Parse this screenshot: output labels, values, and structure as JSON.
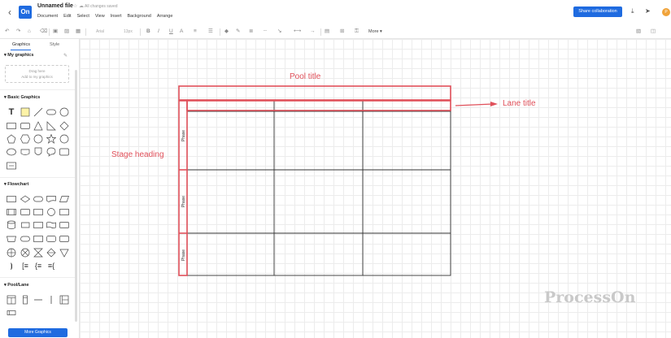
{
  "header": {
    "file_title": "Unnamed file",
    "save_status": "All changes saved",
    "menu": [
      "Document",
      "Edit",
      "Select",
      "View",
      "Insert",
      "Background",
      "Arrange"
    ],
    "share_button": "Share collaboration",
    "logo": "On",
    "avatar_initial": "P"
  },
  "toolbar": {
    "font_family": "Arial",
    "font_size": "13px",
    "more_label": "More"
  },
  "sidebar": {
    "tabs": [
      "Graphics",
      "Style"
    ],
    "my_graphics": {
      "title": "My graphics",
      "drag_line1": "Drag here",
      "drag_line2": "Add to my graphics"
    },
    "basic_graphics_title": "Basic Graphics",
    "flowchart_title": "Flowchart",
    "pool_lane_title": "Pool/Lane",
    "more_graphics": "More Graphics"
  },
  "canvas": {
    "annotations": {
      "pool_title": "Pool title",
      "lane_title": "Lane title",
      "stage_heading": "Stage heading"
    },
    "phase_labels": [
      "Phase",
      "Phase",
      "Phase"
    ],
    "watermark": "ProcessOn",
    "accent_color": "#e0505a"
  }
}
